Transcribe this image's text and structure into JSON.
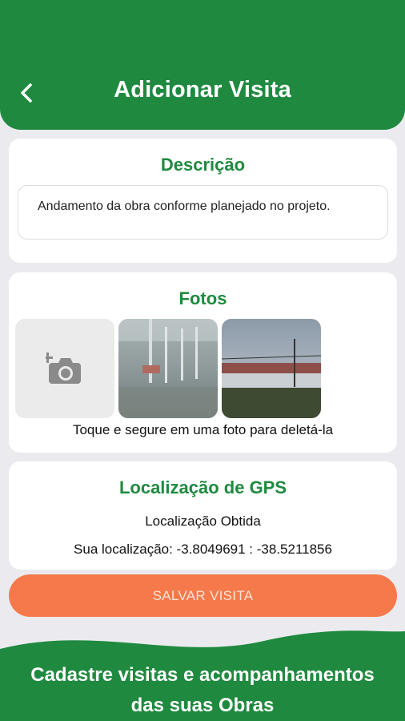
{
  "header": {
    "title": "Adicionar Visita",
    "back_icon": "chevron-left-icon"
  },
  "descricao": {
    "title": "Descrição",
    "value": "Andamento da obra conforme planejado no projeto."
  },
  "fotos": {
    "title": "Fotos",
    "add_icon": "add-camera-icon",
    "hint": "Toque e segure em uma foto para deletá-la"
  },
  "gps": {
    "title": "Localização de GPS",
    "status": "Localização Obtida",
    "coords": "Sua localização: -3.8049691 : -38.5211856"
  },
  "actions": {
    "save_label": "SALVAR VISITA"
  },
  "footer": {
    "line1": "Cadastre visitas e acompanhamentos",
    "line2": "das suas Obras"
  },
  "colors": {
    "primary": "#1f8a3f",
    "accent": "#f5794a",
    "background": "#ebebef"
  }
}
